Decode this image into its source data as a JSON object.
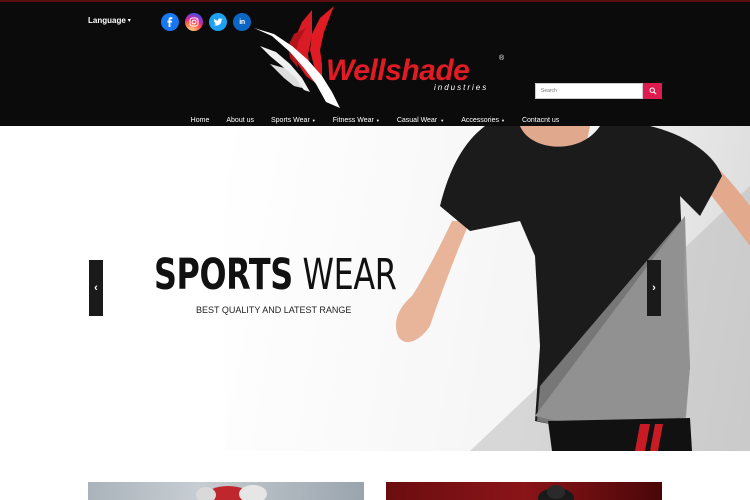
{
  "header": {
    "language_label": "Language",
    "social": [
      {
        "icon": "facebook-icon",
        "glyph": "f",
        "color": "#1877f2"
      },
      {
        "icon": "instagram-icon",
        "glyph": "◎",
        "color": "#d62976"
      },
      {
        "icon": "twitter-icon",
        "glyph": "t",
        "color": "#1da1f2"
      },
      {
        "icon": "linkedin-icon",
        "glyph": "in",
        "color": "#0a66c2"
      }
    ],
    "logo": {
      "brand": "Wellshade",
      "registered": "®",
      "tagline": "industries"
    },
    "search": {
      "placeholder": "Search"
    }
  },
  "nav": {
    "items": [
      {
        "label": "Home",
        "has_dropdown": false
      },
      {
        "label": "About us",
        "has_dropdown": false
      },
      {
        "label": "Sports Wear",
        "has_dropdown": true
      },
      {
        "label": "Fitness Wear",
        "has_dropdown": true
      },
      {
        "label": "Casual Wear",
        "has_dropdown": true
      },
      {
        "label": "Accessories",
        "has_dropdown": true
      },
      {
        "label": "Contacnt us",
        "has_dropdown": false
      }
    ]
  },
  "hero": {
    "title_bold": "SPORTS",
    "title_light": "WEAR",
    "subtitle": "BEST QUALITY AND LATEST RANGE"
  },
  "colors": {
    "accent": "#e01b24",
    "search_button": "#e01b4f",
    "header_bg": "#0b0b0b"
  }
}
